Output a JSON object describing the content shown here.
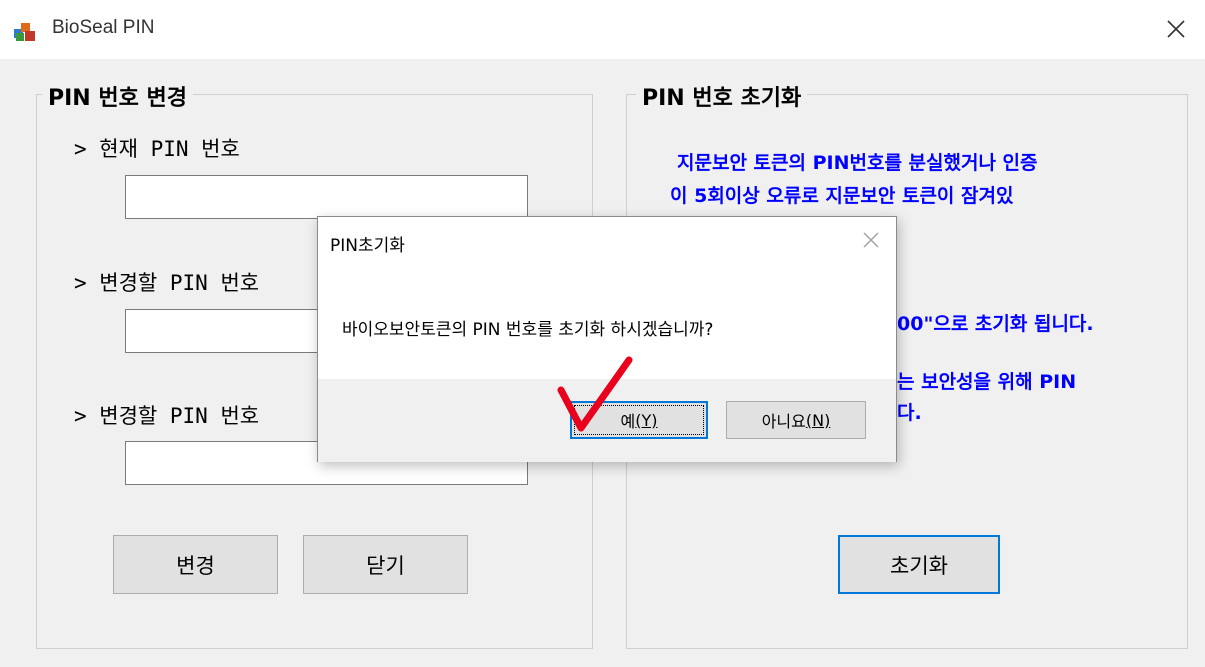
{
  "window": {
    "title": "BioSeal PIN",
    "icon": "bioseal-app-icon",
    "close_icon": "close-icon"
  },
  "change_group": {
    "title": "PIN 번호 변경",
    "current_label": "> 현재 PIN 번호",
    "current_value": "",
    "new_label": "> 변경할 PIN 번호",
    "new_value": "",
    "confirm_label": "> 변경할 PIN 번호 확인",
    "confirm_label_visible": "> 변경할 PIN 번호 ",
    "confirm_value": "",
    "change_button": "변경",
    "close_button": "닫기"
  },
  "reset_group": {
    "title": "PIN 번호 초기화",
    "line1": "지문보안 토큰의 PIN번호를 분실했거나 인증",
    "line2": "이 5회이상 오류로 지문보안 토큰이 잠겨있",
    "line3_partial": "00\"으로 초기화 됩니다.",
    "line4_partial": "는 보안성을 위해 PIN",
    "line5_partial": "다.",
    "reset_button": "초기화"
  },
  "dialog": {
    "title": "PIN초기화",
    "message": "바이오보안토큰의 PIN 번호를 초기화 하시겠습니까?",
    "yes_label": "예",
    "yes_mnemonic": "(Y)",
    "no_label": "아니요",
    "no_mnemonic": "(N)"
  },
  "colors": {
    "info_text": "#0000ff",
    "focus_border": "#0078d7",
    "annotation_check": "#e8001c"
  }
}
